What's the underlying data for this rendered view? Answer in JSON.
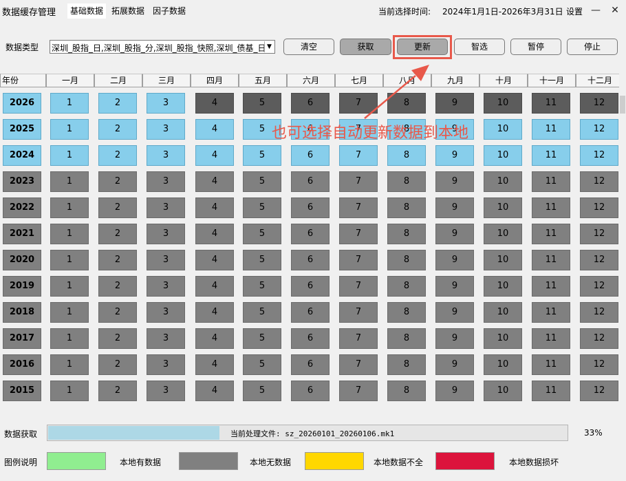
{
  "titlebar": {
    "app_title": "数据缓存管理",
    "tabs": [
      {
        "label": "基础数据",
        "active": true
      },
      {
        "label": "拓展数据",
        "active": false
      },
      {
        "label": "因子数据",
        "active": false
      }
    ],
    "range_label": "当前选择时间:",
    "range_value": "2024年1月1日-2026年3月31日",
    "settings": "设置",
    "minimize": "—",
    "close": "✕"
  },
  "toolbar": {
    "type_label": "数据类型",
    "type_value": "深圳_股指_日,深圳_股指_分,深圳_股指_快照,深圳_债基_日",
    "dropdown_icon": "▼",
    "buttons": {
      "clear": "清空",
      "fetch": "获取",
      "update": "更新",
      "smart": "智选",
      "pause": "暂停",
      "stop": "停止"
    }
  },
  "grid": {
    "headers": [
      "年份",
      "一月",
      "二月",
      "三月",
      "四月",
      "五月",
      "六月",
      "七月",
      "八月",
      "九月",
      "十月",
      "十一月",
      "十二月"
    ],
    "rows": [
      {
        "year": "2026",
        "cells": [
          "1",
          "2",
          "3",
          "4",
          "5",
          "6",
          "7",
          "8",
          "9",
          "10",
          "11",
          "12"
        ],
        "status": [
          "blue",
          "blue",
          "blue",
          "dark",
          "dark",
          "dark",
          "dark",
          "dark",
          "dark",
          "dark",
          "dark",
          "dark"
        ]
      },
      {
        "year": "2025",
        "cells": [
          "1",
          "2",
          "3",
          "4",
          "5",
          "6",
          "7",
          "8",
          "9",
          "10",
          "11",
          "12"
        ],
        "status": [
          "blue",
          "blue",
          "blue",
          "blue",
          "blue",
          "blue",
          "blue",
          "blue",
          "blue",
          "blue",
          "blue",
          "blue"
        ]
      },
      {
        "year": "2024",
        "cells": [
          "1",
          "2",
          "3",
          "4",
          "5",
          "6",
          "7",
          "8",
          "9",
          "10",
          "11",
          "12"
        ],
        "status": [
          "blue",
          "blue",
          "blue",
          "blue",
          "blue",
          "blue",
          "blue",
          "blue",
          "blue",
          "blue",
          "blue",
          "blue"
        ]
      },
      {
        "year": "2023",
        "cells": [
          "1",
          "2",
          "3",
          "4",
          "5",
          "6",
          "7",
          "8",
          "9",
          "10",
          "11",
          "12"
        ],
        "status": [
          "gray",
          "gray",
          "gray",
          "gray",
          "gray",
          "gray",
          "gray",
          "gray",
          "gray",
          "gray",
          "gray",
          "gray"
        ]
      },
      {
        "year": "2022",
        "cells": [
          "1",
          "2",
          "3",
          "4",
          "5",
          "6",
          "7",
          "8",
          "9",
          "10",
          "11",
          "12"
        ],
        "status": [
          "gray",
          "gray",
          "gray",
          "gray",
          "gray",
          "gray",
          "gray",
          "gray",
          "gray",
          "gray",
          "gray",
          "gray"
        ]
      },
      {
        "year": "2021",
        "cells": [
          "1",
          "2",
          "3",
          "4",
          "5",
          "6",
          "7",
          "8",
          "9",
          "10",
          "11",
          "12"
        ],
        "status": [
          "gray",
          "gray",
          "gray",
          "gray",
          "gray",
          "gray",
          "gray",
          "gray",
          "gray",
          "gray",
          "gray",
          "gray"
        ]
      },
      {
        "year": "2020",
        "cells": [
          "1",
          "2",
          "3",
          "4",
          "5",
          "6",
          "7",
          "8",
          "9",
          "10",
          "11",
          "12"
        ],
        "status": [
          "gray",
          "gray",
          "gray",
          "gray",
          "gray",
          "gray",
          "gray",
          "gray",
          "gray",
          "gray",
          "gray",
          "gray"
        ]
      },
      {
        "year": "2019",
        "cells": [
          "1",
          "2",
          "3",
          "4",
          "5",
          "6",
          "7",
          "8",
          "9",
          "10",
          "11",
          "12"
        ],
        "status": [
          "gray",
          "gray",
          "gray",
          "gray",
          "gray",
          "gray",
          "gray",
          "gray",
          "gray",
          "gray",
          "gray",
          "gray"
        ]
      },
      {
        "year": "2018",
        "cells": [
          "1",
          "2",
          "3",
          "4",
          "5",
          "6",
          "7",
          "8",
          "9",
          "10",
          "11",
          "12"
        ],
        "status": [
          "gray",
          "gray",
          "gray",
          "gray",
          "gray",
          "gray",
          "gray",
          "gray",
          "gray",
          "gray",
          "gray",
          "gray"
        ]
      },
      {
        "year": "2017",
        "cells": [
          "1",
          "2",
          "3",
          "4",
          "5",
          "6",
          "7",
          "8",
          "9",
          "10",
          "11",
          "12"
        ],
        "status": [
          "gray",
          "gray",
          "gray",
          "gray",
          "gray",
          "gray",
          "gray",
          "gray",
          "gray",
          "gray",
          "gray",
          "gray"
        ]
      },
      {
        "year": "2016",
        "cells": [
          "1",
          "2",
          "3",
          "4",
          "5",
          "6",
          "7",
          "8",
          "9",
          "10",
          "11",
          "12"
        ],
        "status": [
          "gray",
          "gray",
          "gray",
          "gray",
          "gray",
          "gray",
          "gray",
          "gray",
          "gray",
          "gray",
          "gray",
          "gray"
        ]
      },
      {
        "year": "2015",
        "cells": [
          "1",
          "2",
          "3",
          "4",
          "5",
          "6",
          "7",
          "8",
          "9",
          "10",
          "11",
          "12"
        ],
        "status": [
          "gray",
          "gray",
          "gray",
          "gray",
          "gray",
          "gray",
          "gray",
          "gray",
          "gray",
          "gray",
          "gray",
          "gray"
        ]
      }
    ]
  },
  "annotation": {
    "text": "也可选择自动更新数据到本地",
    "color": "#e8584a"
  },
  "progress": {
    "label": "数据获取",
    "fraction": 0.33,
    "file_text": "当前处理文件: sz_20260101_20260106.mk1",
    "percent_text": "33%"
  },
  "legend": {
    "label": "图例说明",
    "items": [
      {
        "color": "#90ee90",
        "text": "本地有数据"
      },
      {
        "color": "#808080",
        "text": "本地无数据"
      },
      {
        "color": "#ffd700",
        "text": "本地数据不全"
      },
      {
        "color": "#dc143c",
        "text": "本地数据损坏"
      }
    ]
  },
  "colors": {
    "blue": "#87ceeb",
    "gray": "#808080",
    "dark": "#5c5c5c",
    "highlight": "#e8584a"
  }
}
